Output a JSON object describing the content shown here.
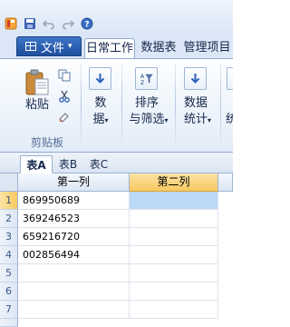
{
  "quick_access": {
    "icons": [
      "app-icon",
      "save-icon",
      "undo-icon",
      "redo-icon",
      "help-icon"
    ]
  },
  "ribbon": {
    "file_menu": {
      "label": "文件",
      "caret": "▾"
    },
    "tabs": [
      {
        "label": "日常工作",
        "active": true
      },
      {
        "label": "数据表",
        "active": false
      },
      {
        "label": "管理项目",
        "active": false
      }
    ],
    "clipboard_group": {
      "label": "剪贴板",
      "paste_label": "粘贴",
      "mini_icons": [
        "copy-icon",
        "cut-icon",
        "format-painter-icon"
      ]
    },
    "data_button": {
      "line1": "数",
      "line2": "据",
      "caret": "▾"
    },
    "sort_filter_button": {
      "line1": "排序",
      "line2": "与筛选",
      "caret": "▾"
    },
    "statistics_button": {
      "line1": "数据",
      "line2": "统计",
      "caret": "▾"
    },
    "truncated_button": {
      "line1": "",
      "line2": "统"
    }
  },
  "sheets": {
    "tabs": [
      {
        "label": "表A",
        "active": true
      },
      {
        "label": "表B",
        "active": false
      },
      {
        "label": "表C",
        "active": false
      }
    ]
  },
  "grid": {
    "columns": [
      {
        "label": "第一列",
        "selected": false
      },
      {
        "label": "第二列",
        "selected": true
      }
    ],
    "rows": [
      {
        "num": "1",
        "cells": [
          "869950689",
          ""
        ]
      },
      {
        "num": "2",
        "cells": [
          "369246523",
          ""
        ]
      },
      {
        "num": "3",
        "cells": [
          "659216720",
          ""
        ]
      },
      {
        "num": "4",
        "cells": [
          "002856494",
          ""
        ]
      },
      {
        "num": "5",
        "cells": [
          "",
          ""
        ]
      },
      {
        "num": "6",
        "cells": [
          "",
          ""
        ]
      },
      {
        "num": "7",
        "cells": [
          "",
          ""
        ]
      }
    ],
    "selected_cell": "B1"
  },
  "colors": {
    "accent": "#1f4f9e",
    "selected_header": "#f7c960",
    "selected_cell": "#bcd8f7",
    "ribbon_bg": "#dbe7f6"
  }
}
